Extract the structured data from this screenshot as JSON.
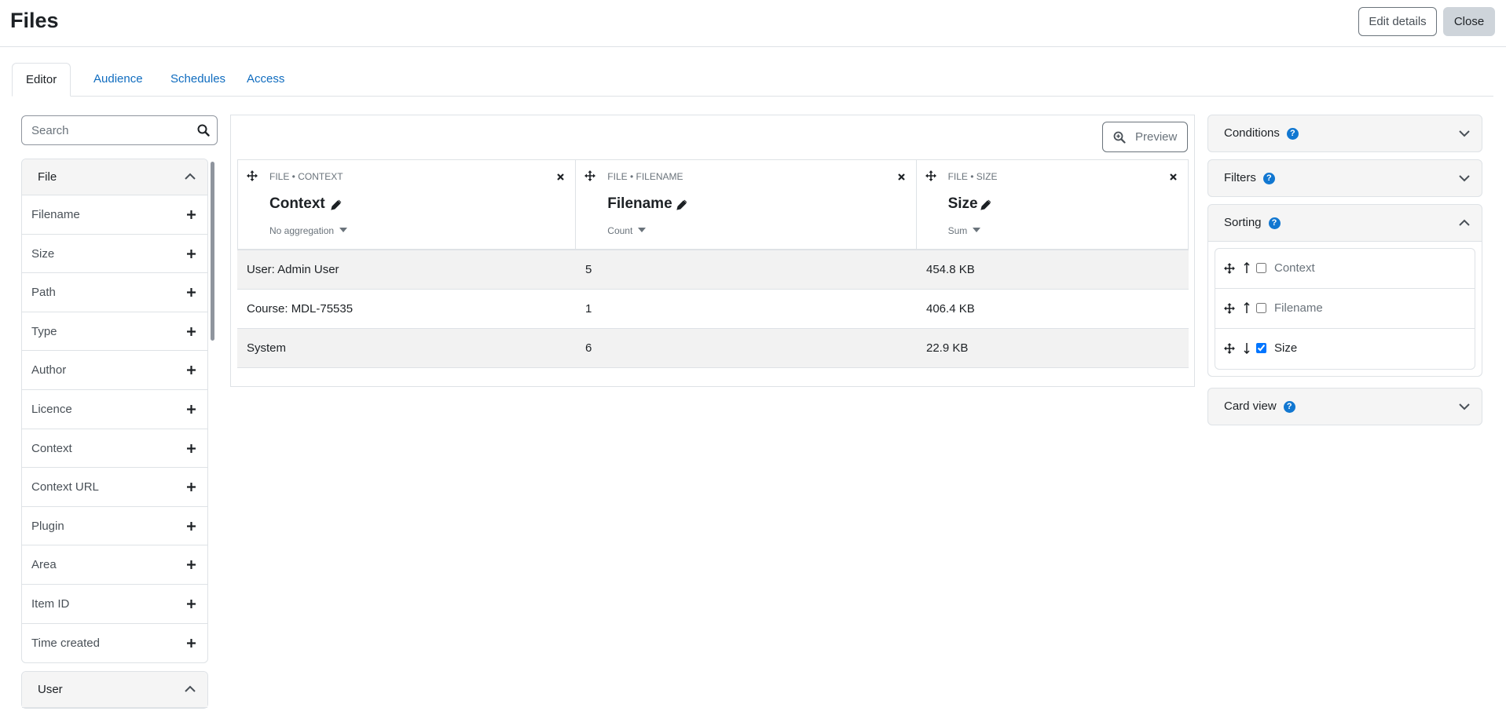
{
  "header": {
    "title": "Files",
    "edit_label": "Edit details",
    "close_label": "Close"
  },
  "tabs": [
    {
      "label": "Editor",
      "active": true
    },
    {
      "label": "Audience",
      "active": false
    },
    {
      "label": "Schedules",
      "active": false
    },
    {
      "label": "Access",
      "active": false
    }
  ],
  "search": {
    "placeholder": "Search",
    "value": ""
  },
  "sidebar": {
    "file_group": {
      "title": "File",
      "items": [
        "Filename",
        "Size",
        "Path",
        "Type",
        "Author",
        "Licence",
        "Context",
        "Context URL",
        "Plugin",
        "Area",
        "Item ID",
        "Time created"
      ]
    },
    "user_group": {
      "title": "User"
    }
  },
  "report": {
    "preview_label": "Preview",
    "columns": [
      {
        "path": "FILE • CONTEXT",
        "name": "Context",
        "aggregation": "No aggregation"
      },
      {
        "path": "FILE • FILENAME",
        "name": "Filename",
        "aggregation": "Count"
      },
      {
        "path": "FILE • SIZE",
        "name": "Size",
        "aggregation": "Sum"
      }
    ],
    "rows": [
      [
        "User: Admin User",
        "5",
        "454.8 KB"
      ],
      [
        "Course: MDL-75535",
        "1",
        "406.4 KB"
      ],
      [
        "System",
        "6",
        "22.9 KB"
      ]
    ]
  },
  "panels": {
    "conditions": "Conditions",
    "filters": "Filters",
    "sorting": "Sorting",
    "card_view": "Card view",
    "sort_items": [
      {
        "label": "Context",
        "direction": "asc",
        "checked": false
      },
      {
        "label": "Filename",
        "direction": "asc",
        "checked": false
      },
      {
        "label": "Size",
        "direction": "desc",
        "checked": true
      }
    ]
  },
  "colors": {
    "link": "#0f6cbf",
    "help": "#1177d1",
    "border": "#dee2e6",
    "header_bg": "#f5f5f5"
  }
}
